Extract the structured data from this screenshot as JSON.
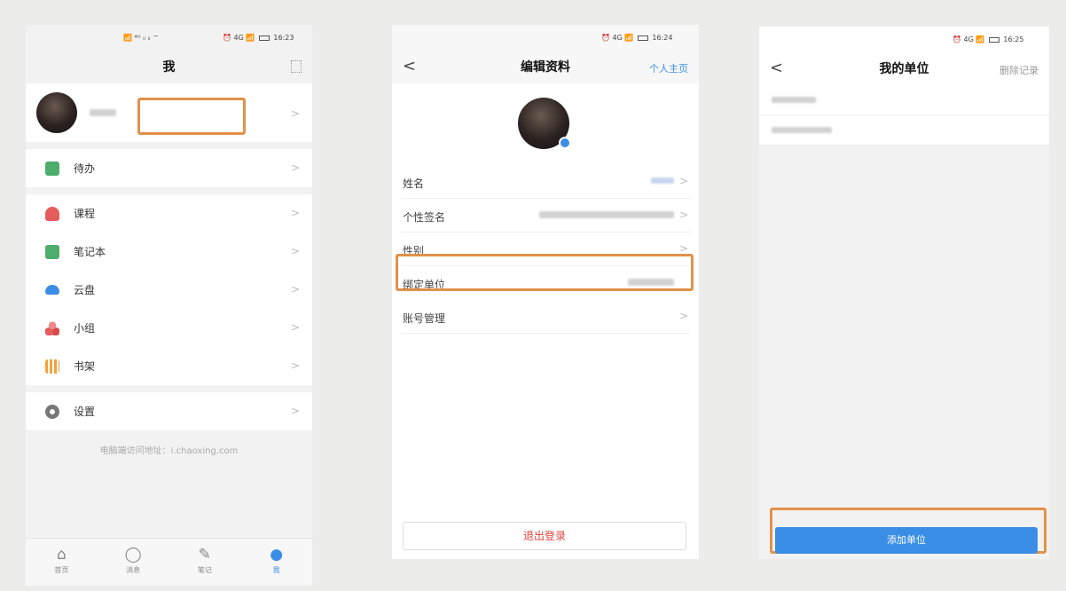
{
  "phone1": {
    "status_time": "16:23",
    "status_right": "⏰ 4G 📶",
    "status_left": "📶 ⁴ᴳ ᵢₗ ᵢₗ ⌔",
    "nav_title": "我",
    "qr_icon": "qr-code-icon",
    "menu_group1": [
      {
        "label": "待办",
        "icon_color": "#4cae6a"
      }
    ],
    "menu_group2": [
      {
        "label": "课程",
        "icon_color": "#e55c5c"
      },
      {
        "label": "笔记本",
        "icon_color": "#4cae6a"
      },
      {
        "label": "云盘",
        "icon_color": "#3a8ee6"
      },
      {
        "label": "小组",
        "icon_color": "#e55c5c"
      },
      {
        "label": "书架",
        "icon_color": "#f0a23b"
      }
    ],
    "settings_label": "设置",
    "footer": "电脑端访问地址：i.chaoxing.com",
    "tabs": [
      {
        "label": "首页",
        "icon": "⌂"
      },
      {
        "label": "消息",
        "icon": "◯"
      },
      {
        "label": "笔记",
        "icon": "✎"
      },
      {
        "label": "我",
        "icon": "●"
      }
    ]
  },
  "phone2": {
    "status_time": "16:24",
    "nav_title": "编辑资料",
    "nav_right": "个人主页",
    "fields": [
      {
        "label": "姓名"
      },
      {
        "label": "个性签名"
      },
      {
        "label": "性别"
      },
      {
        "label": "绑定单位"
      },
      {
        "label": "账号管理"
      }
    ],
    "logout": "退出登录"
  },
  "phone3": {
    "status_time": "16:25",
    "nav_title": "我的单位",
    "nav_right": "删除记录",
    "add_button": "添加单位"
  },
  "colors": {
    "accent_blue": "#3a8ee6",
    "highlight_orange": "#e2914a",
    "logout_red": "#e0433b"
  }
}
